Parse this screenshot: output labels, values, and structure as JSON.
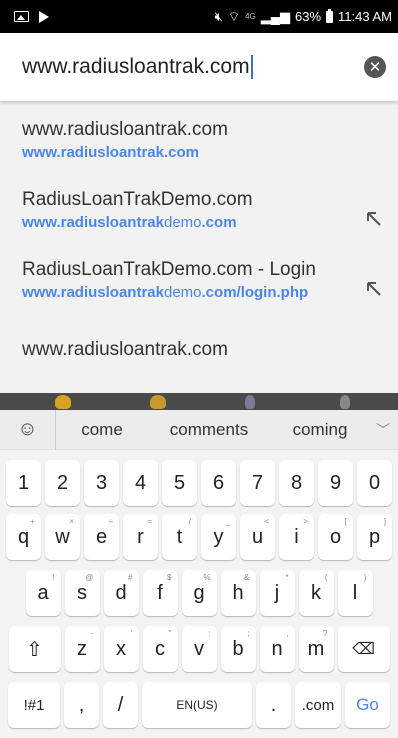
{
  "status": {
    "battery": "63%",
    "time": "11:43 AM",
    "network": "4G"
  },
  "address": {
    "value": "www.radiusloantrak.com"
  },
  "suggestions": [
    {
      "title": "www.radiusloantrak.com",
      "url_bold": "www.radiusloantrak.com",
      "url_rest": "",
      "url_tail": "",
      "has_arrow": false
    },
    {
      "title": "RadiusLoanTrakDemo.com",
      "url_bold": "www.radiusloantrak",
      "url_rest": "demo",
      "url_tail": ".com",
      "has_arrow": true
    },
    {
      "title": "RadiusLoanTrakDemo.com - Login",
      "url_bold": "www.radiusloantrak",
      "url_rest": "demo",
      "url_tail": ".com/login.php",
      "has_arrow": true
    },
    {
      "title": "www.radiusloantrak.com",
      "url_bold": "",
      "url_rest": "",
      "url_tail": "",
      "has_arrow": false
    }
  ],
  "keyboard": {
    "predictions": [
      "come",
      "comments",
      "coming"
    ],
    "numbers": [
      "1",
      "2",
      "3",
      "4",
      "5",
      "6",
      "7",
      "8",
      "9",
      "0"
    ],
    "row1": [
      {
        "k": "q",
        "s": "+"
      },
      {
        "k": "w",
        "s": "×"
      },
      {
        "k": "e",
        "s": "÷"
      },
      {
        "k": "r",
        "s": "="
      },
      {
        "k": "t",
        "s": "/"
      },
      {
        "k": "y",
        "s": "_"
      },
      {
        "k": "u",
        "s": "<"
      },
      {
        "k": "i",
        "s": ">"
      },
      {
        "k": "o",
        "s": "["
      },
      {
        "k": "p",
        "s": "]"
      }
    ],
    "row2": [
      {
        "k": "a",
        "s": "!"
      },
      {
        "k": "s",
        "s": "@"
      },
      {
        "k": "d",
        "s": "#"
      },
      {
        "k": "f",
        "s": "$"
      },
      {
        "k": "g",
        "s": "%"
      },
      {
        "k": "h",
        "s": "&"
      },
      {
        "k": "j",
        "s": "*"
      },
      {
        "k": "k",
        "s": "("
      },
      {
        "k": "l",
        "s": ")"
      }
    ],
    "row3": [
      {
        "k": "z",
        "s": "-"
      },
      {
        "k": "x",
        "s": "'"
      },
      {
        "k": "c",
        "s": "\""
      },
      {
        "k": "v",
        "s": ":"
      },
      {
        "k": "b",
        "s": ";"
      },
      {
        "k": "n",
        "s": ","
      },
      {
        "k": "m",
        "s": "?"
      }
    ],
    "symbols_label": "!#1",
    "comma": ",",
    "slash": "/",
    "space_label": "EN(US)",
    "period": ".",
    "dotcom": ".com",
    "go_label": "Go"
  },
  "colors": {
    "accent": "#4a86e8",
    "caret": "#3d6fd9"
  }
}
